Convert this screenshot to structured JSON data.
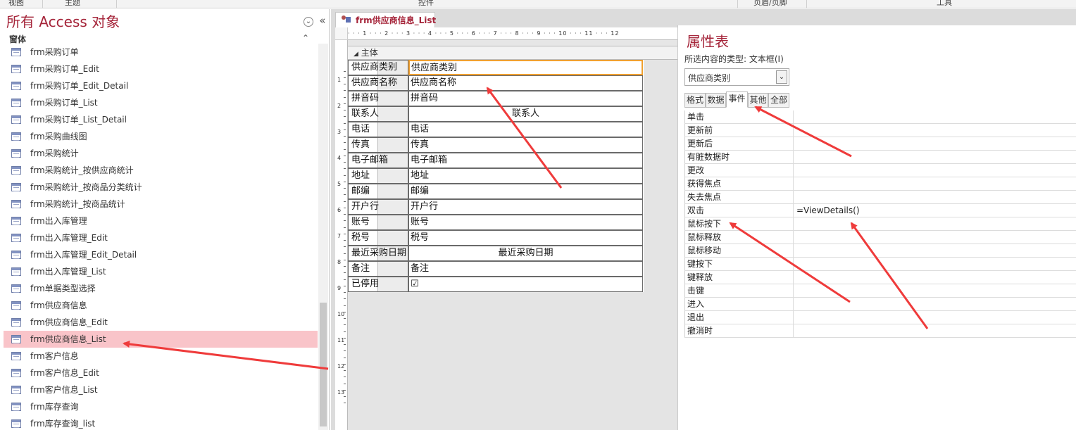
{
  "ribbon": {
    "groups": [
      "视图",
      "主题",
      "控件",
      "页眉/页脚",
      "工具"
    ]
  },
  "nav": {
    "title": "所有 Access 对象",
    "section": "窗体",
    "items": [
      "frm采购订单",
      "frm采购订单_Edit",
      "frm采购订单_Edit_Detail",
      "frm采购订单_List",
      "frm采购订单_List_Detail",
      "frm采购曲线图",
      "frm采购统计",
      "frm采购统计_按供应商统计",
      "frm采购统计_按商品分类统计",
      "frm采购统计_按商品统计",
      "frm出入库管理",
      "frm出入库管理_Edit",
      "frm出入库管理_Edit_Detail",
      "frm出入库管理_List",
      "frm单据类型选择",
      "frm供应商信息",
      "frm供应商信息_Edit",
      "frm供应商信息_List",
      "frm客户信息",
      "frm客户信息_Edit",
      "frm客户信息_List",
      "frm库存查询",
      "frm库存查询_list"
    ],
    "selected_index": 17,
    "dropdown_glyph": "⌄",
    "collapse_glyph": "«",
    "section_collapse_glyph": "⌃"
  },
  "designer": {
    "tab_label": "frm供应商信息_List",
    "section_label": "主体",
    "section_glyph": "◢",
    "ruler_text": "· · · 1 · · · 2 · · · 3 · · · 4 · · · 5 · · · 6 · · · 7 · · · 8 · · · 9 · · · 10 · · · 11 · · · 12",
    "vruler": [
      "1",
      "2",
      "3",
      "4",
      "5",
      "6",
      "7",
      "8",
      "9",
      "10",
      "11",
      "12",
      "13"
    ],
    "controls": [
      {
        "label": "供应商类别",
        "value": "供应商类别"
      },
      {
        "label": "供应商名称",
        "value": "供应商名称"
      },
      {
        "label": "拼音码",
        "value": "拼音码"
      },
      {
        "label": "联系人",
        "value": "联系人"
      },
      {
        "label": "电话",
        "value": "电话"
      },
      {
        "label": "传真",
        "value": "传真"
      },
      {
        "label": "电子邮箱",
        "value": "电子邮箱"
      },
      {
        "label": "地址",
        "value": "地址"
      },
      {
        "label": "邮编",
        "value": "邮编"
      },
      {
        "label": "开户行",
        "value": "开户行"
      },
      {
        "label": "账号",
        "value": "账号"
      },
      {
        "label": "税号",
        "value": "税号"
      },
      {
        "label": "最近采购日期",
        "value": "最近采购日期"
      },
      {
        "label": "备注",
        "value": "备注"
      },
      {
        "label": "已停用",
        "value": "☑"
      }
    ]
  },
  "props": {
    "title": "属性表",
    "type_text": "所选内容的类型: 文本框(I)",
    "selected_control": "供应商类别",
    "dropdown_glyph": "⌄",
    "tabs": [
      "格式",
      "数据",
      "事件",
      "其他",
      "全部"
    ],
    "active_tab": 2,
    "rows": [
      {
        "name": "单击",
        "value": ""
      },
      {
        "name": "更新前",
        "value": ""
      },
      {
        "name": "更新后",
        "value": ""
      },
      {
        "name": "有脏数据时",
        "value": ""
      },
      {
        "name": "更改",
        "value": ""
      },
      {
        "name": "获得焦点",
        "value": ""
      },
      {
        "name": "失去焦点",
        "value": ""
      },
      {
        "name": "双击",
        "value": "=ViewDetails()"
      },
      {
        "name": "鼠标按下",
        "value": ""
      },
      {
        "name": "鼠标释放",
        "value": ""
      },
      {
        "name": "鼠标移动",
        "value": ""
      },
      {
        "name": "键按下",
        "value": ""
      },
      {
        "name": "键释放",
        "value": ""
      },
      {
        "name": "击键",
        "value": ""
      },
      {
        "name": "进入",
        "value": ""
      },
      {
        "name": "退出",
        "value": ""
      },
      {
        "name": "撤消时",
        "value": ""
      }
    ]
  },
  "colors": {
    "accent": "#a5253a",
    "selection": "#f9c4c9",
    "arrow": "#ef3b3b",
    "control_selected": "#f0a030"
  }
}
